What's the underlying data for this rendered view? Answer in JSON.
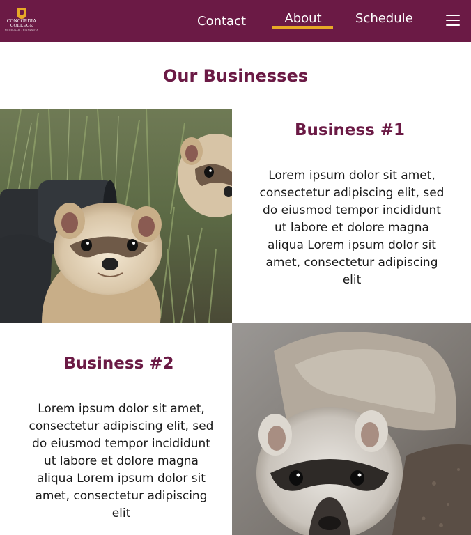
{
  "header": {
    "logo": {
      "line1": "CONCORDIA",
      "line2": "COLLEGE",
      "subline": "MOORHEAD · MINNESOTA"
    },
    "nav": [
      {
        "label": "Contact"
      },
      {
        "label": "About",
        "active": true
      },
      {
        "label": "Schedule"
      }
    ],
    "menu_icon": "hamburger-menu-icon"
  },
  "page": {
    "title": "Our Businesses"
  },
  "businesses": [
    {
      "title": "Business #1",
      "description": "Lorem ipsum dolor sit amet, consectetur adipiscing elit, sed do eiusmod tempor incididunt ut labore et dolore magna aliqua Lorem ipsum dolor sit amet, consectetur adipiscing elit"
    },
    {
      "title": "Business #2",
      "description": "Lorem ipsum dolor sit amet, consectetur adipiscing elit, sed do eiusmod tempor incididunt ut labore et dolore magna aliqua Lorem ipsum dolor sit amet, consectetur adipiscing elit"
    }
  ],
  "colors": {
    "brand_maroon": "#6b1a45",
    "accent_gold": "#e7a927",
    "text_dark": "#1a1a1a",
    "background": "#ffffff"
  }
}
